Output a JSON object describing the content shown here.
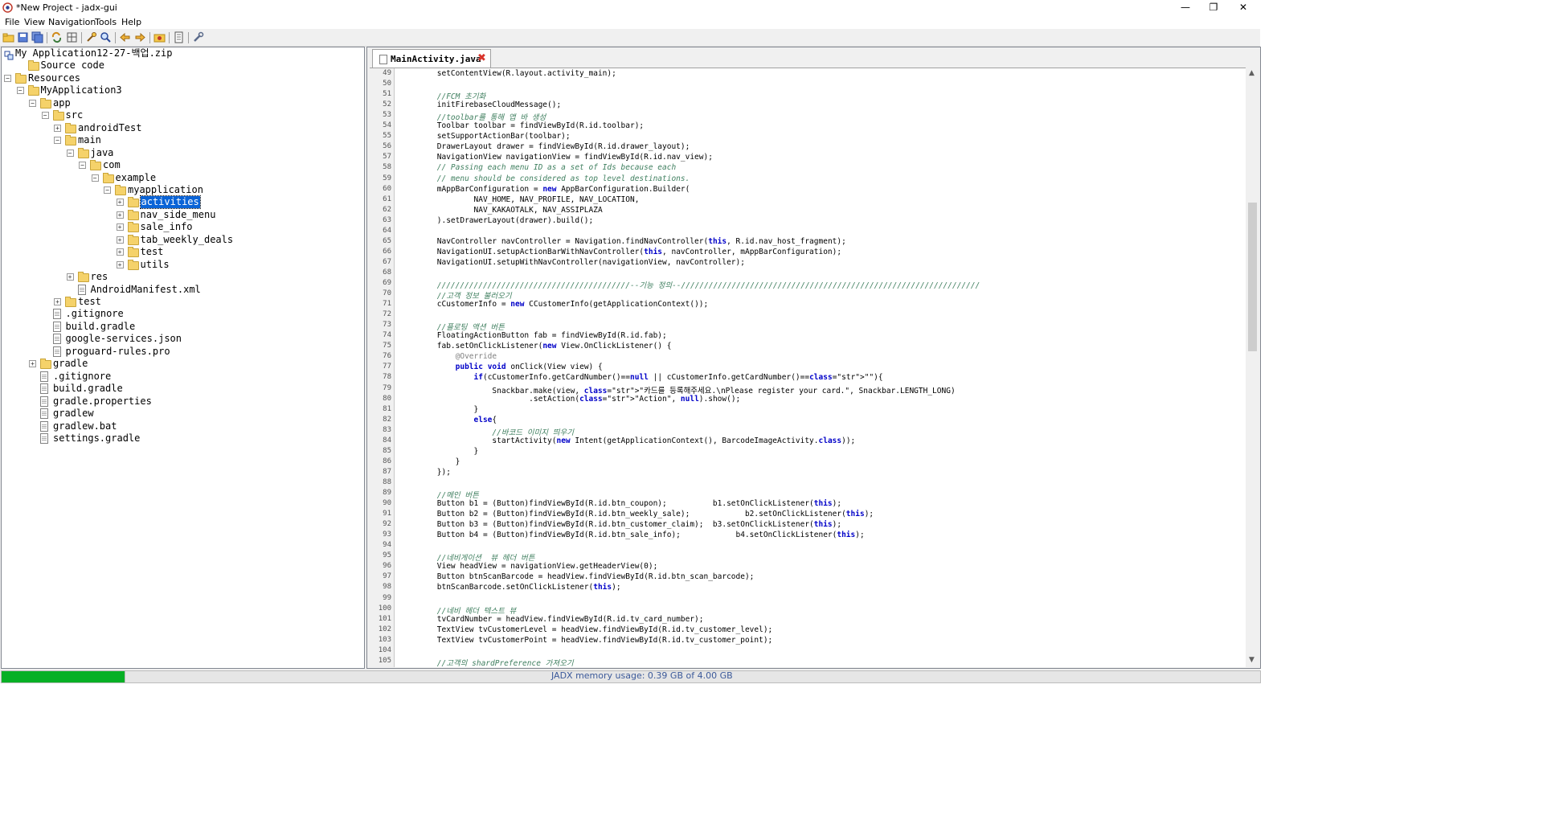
{
  "window": {
    "title": "*New Project - jadx-gui",
    "minimize": "—",
    "maximize": "❐",
    "close": "✕"
  },
  "menu": [
    "File",
    "View",
    "Navigation",
    "Tools",
    "Help"
  ],
  "toolbar_icons": [
    "open-icon",
    "save-icon",
    "save-all-icon",
    "sync-icon",
    "flatten-icon",
    "find-icon",
    "search-icon",
    "back-icon",
    "forward-icon",
    "deobfuscate-icon",
    "log-icon",
    "preferences-icon"
  ],
  "tree": [
    {
      "label": "My Application12-27-백업.zip",
      "depth": 0,
      "icon": "root",
      "exp": ""
    },
    {
      "label": "Source code",
      "depth": 1,
      "icon": "folder-pkg",
      "exp": ""
    },
    {
      "label": "Resources",
      "depth": 0,
      "icon": "folder-pkg",
      "exp": "−"
    },
    {
      "label": "MyApplication3",
      "depth": 1,
      "icon": "folder",
      "exp": "−"
    },
    {
      "label": "app",
      "depth": 2,
      "icon": "folder",
      "exp": "−"
    },
    {
      "label": "src",
      "depth": 3,
      "icon": "folder",
      "exp": "−"
    },
    {
      "label": "androidTest",
      "depth": 4,
      "icon": "folder",
      "exp": "+"
    },
    {
      "label": "main",
      "depth": 4,
      "icon": "folder",
      "exp": "−"
    },
    {
      "label": "java",
      "depth": 5,
      "icon": "folder",
      "exp": "−"
    },
    {
      "label": "com",
      "depth": 6,
      "icon": "folder",
      "exp": "−"
    },
    {
      "label": "example",
      "depth": 7,
      "icon": "folder",
      "exp": "−"
    },
    {
      "label": "myapplication",
      "depth": 8,
      "icon": "folder",
      "exp": "−"
    },
    {
      "label": "activities",
      "depth": 9,
      "icon": "folder",
      "exp": "+",
      "selected": true
    },
    {
      "label": "nav_side_menu",
      "depth": 9,
      "icon": "folder",
      "exp": "+"
    },
    {
      "label": "sale_info",
      "depth": 9,
      "icon": "folder",
      "exp": "+"
    },
    {
      "label": "tab_weekly_deals",
      "depth": 9,
      "icon": "folder",
      "exp": "+"
    },
    {
      "label": "test",
      "depth": 9,
      "icon": "folder",
      "exp": "+"
    },
    {
      "label": "utils",
      "depth": 9,
      "icon": "folder",
      "exp": "+"
    },
    {
      "label": "res",
      "depth": 5,
      "icon": "folder",
      "exp": "+"
    },
    {
      "label": "AndroidManifest.xml",
      "depth": 5,
      "icon": "file",
      "exp": ""
    },
    {
      "label": "test",
      "depth": 4,
      "icon": "folder",
      "exp": "+"
    },
    {
      "label": ".gitignore",
      "depth": 3,
      "icon": "file",
      "exp": ""
    },
    {
      "label": "build.gradle",
      "depth": 3,
      "icon": "file",
      "exp": ""
    },
    {
      "label": "google-services.json",
      "depth": 3,
      "icon": "file",
      "exp": ""
    },
    {
      "label": "proguard-rules.pro",
      "depth": 3,
      "icon": "file",
      "exp": ""
    },
    {
      "label": "gradle",
      "depth": 2,
      "icon": "folder",
      "exp": "+"
    },
    {
      "label": ".gitignore",
      "depth": 2,
      "icon": "file",
      "exp": ""
    },
    {
      "label": "build.gradle",
      "depth": 2,
      "icon": "file",
      "exp": ""
    },
    {
      "label": "gradle.properties",
      "depth": 2,
      "icon": "file",
      "exp": ""
    },
    {
      "label": "gradlew",
      "depth": 2,
      "icon": "file",
      "exp": ""
    },
    {
      "label": "gradlew.bat",
      "depth": 2,
      "icon": "file",
      "exp": ""
    },
    {
      "label": "settings.gradle",
      "depth": 2,
      "icon": "file",
      "exp": ""
    }
  ],
  "tab": {
    "label": "MainActivity.java",
    "close": "✖"
  },
  "code_lines": [
    {
      "n": "49",
      "t": "        setContentView(R.layout.activity_main);"
    },
    {
      "n": "50",
      "t": ""
    },
    {
      "n": "51",
      "t": "        //FCM 초기화",
      "c": "cm"
    },
    {
      "n": "52",
      "t": "        initFirebaseCloudMessage();"
    },
    {
      "n": "53",
      "t": "        //toolbar를 통해 앱 바 생성",
      "c": "cm"
    },
    {
      "n": "54",
      "t": "        Toolbar toolbar = findViewById(R.id.toolbar);"
    },
    {
      "n": "55",
      "t": "        setSupportActionBar(toolbar);"
    },
    {
      "n": "56",
      "t": "        DrawerLayout drawer = findViewById(R.id.drawer_layout);"
    },
    {
      "n": "57",
      "t": "        NavigationView navigationView = findViewById(R.id.nav_view);"
    },
    {
      "n": "58",
      "t": "        // Passing each menu ID as a set of Ids because each",
      "c": "cm"
    },
    {
      "n": "59",
      "t": "        // menu should be considered as top level destinations.",
      "c": "cm"
    },
    {
      "n": "60",
      "t": "        mAppBarConfiguration = new AppBarConfiguration.Builder("
    },
    {
      "n": "61",
      "t": "                NAV_HOME, NAV_PROFILE, NAV_LOCATION,"
    },
    {
      "n": "62",
      "t": "                NAV_KAKAOTALK, NAV_ASSIPLAZA"
    },
    {
      "n": "63",
      "t": "        ).setDrawerLayout(drawer).build();"
    },
    {
      "n": "64",
      "t": ""
    },
    {
      "n": "65",
      "t": "        NavController navController = Navigation.findNavController(this, R.id.nav_host_fragment);"
    },
    {
      "n": "66",
      "t": "        NavigationUI.setupActionBarWithNavController(this, navController, mAppBarConfiguration);"
    },
    {
      "n": "67",
      "t": "        NavigationUI.setupWithNavController(navigationView, navController);"
    },
    {
      "n": "68",
      "t": ""
    },
    {
      "n": "69",
      "t": "        //////////////////////////////////////////--기능 정의--/////////////////////////////////////////////////////////////////",
      "c": "cm"
    },
    {
      "n": "70",
      "t": "        //고객 정보 불러오기",
      "c": "cm"
    },
    {
      "n": "71",
      "t": "        cCustomerInfo = new CCustomerInfo(getApplicationContext());"
    },
    {
      "n": "72",
      "t": ""
    },
    {
      "n": "73",
      "t": "        //플로팅 액션 버튼",
      "c": "cm"
    },
    {
      "n": "74",
      "t": "        FloatingActionButton fab = findViewById(R.id.fab);"
    },
    {
      "n": "75",
      "t": "        fab.setOnClickListener(new View.OnClickListener() {"
    },
    {
      "n": "76",
      "t": "            @Override",
      "c": "ann"
    },
    {
      "n": "77",
      "t": "            public void onClick(View view) {"
    },
    {
      "n": "78",
      "t": "                if(cCustomerInfo.getCardNumber()==null || cCustomerInfo.getCardNumber()==\"\"){"
    },
    {
      "n": "79",
      "t": "                    Snackbar.make(view, \"카드를 등록해주세요.\\nPlease register your card.\", Snackbar.LENGTH_LONG)"
    },
    {
      "n": "80",
      "t": "                            .setAction(\"Action\", null).show();"
    },
    {
      "n": "81",
      "t": "                }"
    },
    {
      "n": "82",
      "t": "                else{"
    },
    {
      "n": "83",
      "t": "                    //바코드 이미지 띄우기",
      "c": "cm"
    },
    {
      "n": "84",
      "t": "                    startActivity(new Intent(getApplicationContext(), BarcodeImageActivity.class));"
    },
    {
      "n": "85",
      "t": "                }"
    },
    {
      "n": "86",
      "t": "            }"
    },
    {
      "n": "87",
      "t": "        });"
    },
    {
      "n": "88",
      "t": ""
    },
    {
      "n": "89",
      "t": "        //메인 버튼",
      "c": "cm"
    },
    {
      "n": "90",
      "t": "        Button b1 = (Button)findViewById(R.id.btn_coupon);          b1.setOnClickListener(this);"
    },
    {
      "n": "91",
      "t": "        Button b2 = (Button)findViewById(R.id.btn_weekly_sale);            b2.setOnClickListener(this);"
    },
    {
      "n": "92",
      "t": "        Button b3 = (Button)findViewById(R.id.btn_customer_claim);  b3.setOnClickListener(this);"
    },
    {
      "n": "93",
      "t": "        Button b4 = (Button)findViewById(R.id.btn_sale_info);            b4.setOnClickListener(this);"
    },
    {
      "n": "94",
      "t": ""
    },
    {
      "n": "95",
      "t": "        //네비게이션  뷰 헤더 버튼",
      "c": "cm"
    },
    {
      "n": "96",
      "t": "        View headView = navigationView.getHeaderView(0);"
    },
    {
      "n": "97",
      "t": "        Button btnScanBarcode = headView.findViewById(R.id.btn_scan_barcode);"
    },
    {
      "n": "98",
      "t": "        btnScanBarcode.setOnClickListener(this);"
    },
    {
      "n": "99",
      "t": ""
    },
    {
      "n": "100",
      "t": "        //네비 헤더 텍스트 뷰",
      "c": "cm"
    },
    {
      "n": "101",
      "t": "        tvCardNumber = headView.findViewById(R.id.tv_card_number);"
    },
    {
      "n": "102",
      "t": "        TextView tvCustomerLevel = headView.findViewById(R.id.tv_customer_level);"
    },
    {
      "n": "103",
      "t": "        TextView tvCustomerPoint = headView.findViewById(R.id.tv_customer_point);"
    },
    {
      "n": "104",
      "t": ""
    },
    {
      "n": "105",
      "t": "        //고객의 shardPreference 가져오기",
      "c": "cm"
    }
  ],
  "status": {
    "memory_text": "JADX memory usage: 0.39 GB of 4.00 GB",
    "memory_fraction": 0.0975
  }
}
